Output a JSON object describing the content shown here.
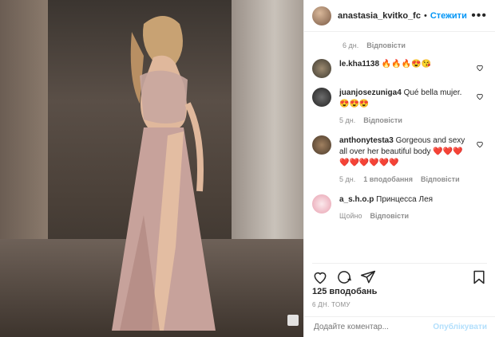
{
  "header": {
    "username": "anastasia_kvitko_fc",
    "follow_label": "Стежити",
    "more_label": "•••"
  },
  "caption_meta": {
    "age": "6 дн.",
    "reply_label": "Відповісти"
  },
  "comments": [
    {
      "username": "le.kha1138",
      "text": "🔥🔥🔥😍😘",
      "age": "",
      "likes": "",
      "reply": ""
    },
    {
      "username": "juanjosezuniga4",
      "text": "Qué bella mujer. 😍😍😍",
      "age": "5 дн.",
      "likes": "",
      "reply": "Відповісти"
    },
    {
      "username": "anthonytesta3",
      "text": "Gorgeous and sexy all over her beautiful body ❤️❤️❤️❤️❤️❤️❤️❤️❤️",
      "age": "5 дн.",
      "likes": "1 вподобання",
      "reply": "Відповісти"
    },
    {
      "username": "a_s.h.o.p",
      "text": "Принцесса Лея",
      "age": "Щойно",
      "likes": "",
      "reply": "Відповісти"
    }
  ],
  "actions": {
    "like_icon": "heart-icon",
    "comment_icon": "comment-icon",
    "share_icon": "share-icon",
    "save_icon": "bookmark-icon"
  },
  "likes_text": "125 вподобань",
  "timestamp": "6 ДН. ТОМУ",
  "add_comment": {
    "placeholder": "Додайте коментар...",
    "publish_label": "Опублікувати"
  },
  "colors": {
    "accent": "#0095f6",
    "muted": "#8e8e8e",
    "publish_disabled": "#b2dffc"
  }
}
